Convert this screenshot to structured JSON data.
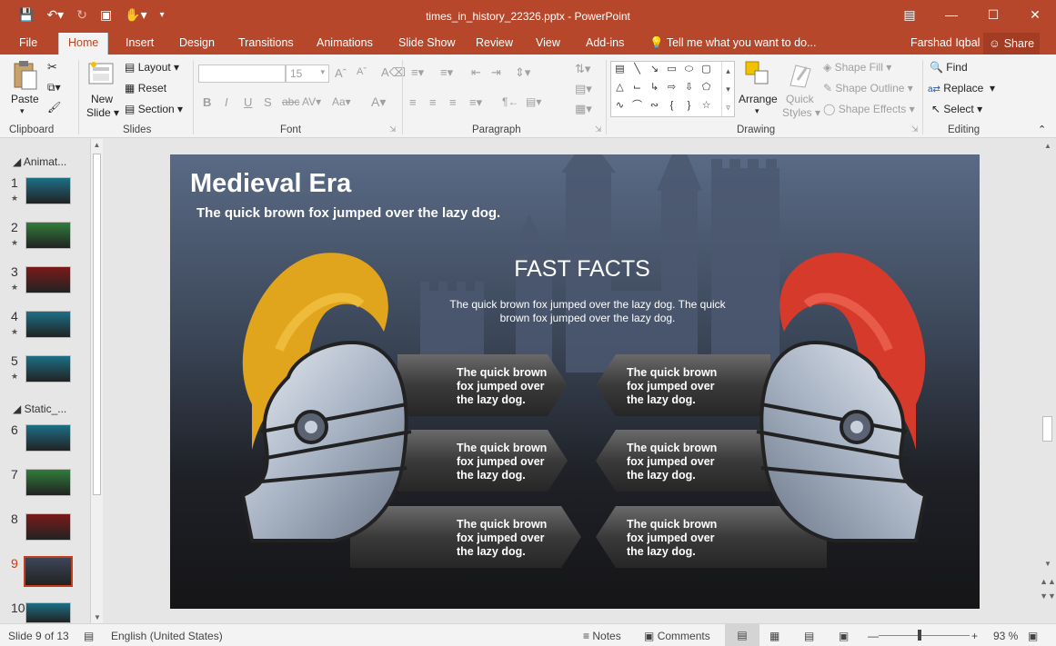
{
  "title_bar": {
    "document_title": "times_in_history_22326.pptx - PowerPoint",
    "qat_icons": [
      "save-icon",
      "undo-icon",
      "redo-icon",
      "start-from-beginning-icon",
      "touch-mode-icon",
      "customize-qat-icon"
    ]
  },
  "tabs": [
    {
      "label": "File"
    },
    {
      "label": "Home",
      "active": true
    },
    {
      "label": "Insert"
    },
    {
      "label": "Design"
    },
    {
      "label": "Transitions"
    },
    {
      "label": "Animations"
    },
    {
      "label": "Slide Show"
    },
    {
      "label": "Review"
    },
    {
      "label": "View"
    },
    {
      "label": "Add-ins"
    }
  ],
  "tell_me": "Tell me what you want to do...",
  "user_name": "Farshad Iqbal",
  "share_label": "Share",
  "ribbon": {
    "clipboard": {
      "paste": "Paste",
      "group": "Clipboard"
    },
    "slides": {
      "new_slide_1": "New",
      "new_slide_2": "Slide",
      "layout": "Layout",
      "reset": "Reset",
      "section": "Section",
      "group": "Slides"
    },
    "font": {
      "size": "15",
      "group": "Font"
    },
    "paragraph": {
      "group": "Paragraph"
    },
    "drawing": {
      "arrange": "Arrange",
      "quick_styles_1": "Quick",
      "quick_styles_2": "Styles",
      "shape_fill": "Shape Fill",
      "shape_outline": "Shape Outline",
      "shape_effects": "Shape Effects",
      "group": "Drawing"
    },
    "editing": {
      "find": "Find",
      "replace": "Replace",
      "select": "Select",
      "group": "Editing"
    }
  },
  "thumbnails": {
    "sections": [
      "Animat...",
      "Static_..."
    ],
    "slides": [
      {
        "num": "1",
        "color": "#1b6f86"
      },
      {
        "num": "2",
        "color": "#2f7d3a"
      },
      {
        "num": "3",
        "color": "#7a1a1a"
      },
      {
        "num": "4",
        "color": "#1b6f86"
      },
      {
        "num": "5",
        "color": "#1b6f86"
      },
      {
        "num": "6",
        "color": "#1b6f86"
      },
      {
        "num": "7",
        "color": "#2f7d3a"
      },
      {
        "num": "8",
        "color": "#7a1a1a"
      },
      {
        "num": "9",
        "color": "#3b4658"
      },
      {
        "num": "10",
        "color": "#1b6f86"
      }
    ],
    "selected": "9"
  },
  "slide": {
    "title": "Medieval Era",
    "subtitle": "The quick brown fox jumped over the lazy dog.",
    "fast_facts_title": "FAST FACTS",
    "fast_facts_text": "The quick brown fox jumped over the lazy dog. The quick brown fox jumped over the lazy dog.",
    "arrows": [
      "The quick brown fox jumped over the lazy dog.",
      "The quick brown fox jumped over the lazy dog.",
      "The quick brown fox jumped over the lazy dog.",
      "The quick brown fox jumped over the lazy dog.",
      "The quick brown fox jumped over the lazy dog.",
      "The quick brown fox jumped over the lazy dog."
    ],
    "helmet_colors": {
      "left_plume": "#e0a51c",
      "right_plume": "#d63a2a"
    }
  },
  "status": {
    "slide_info": "Slide 9 of 13",
    "language": "English (United States)",
    "notes": "Notes",
    "comments": "Comments",
    "zoom": "93 %"
  },
  "colors": {
    "accent": "#b7472a",
    "selection": "#c43e1c"
  }
}
